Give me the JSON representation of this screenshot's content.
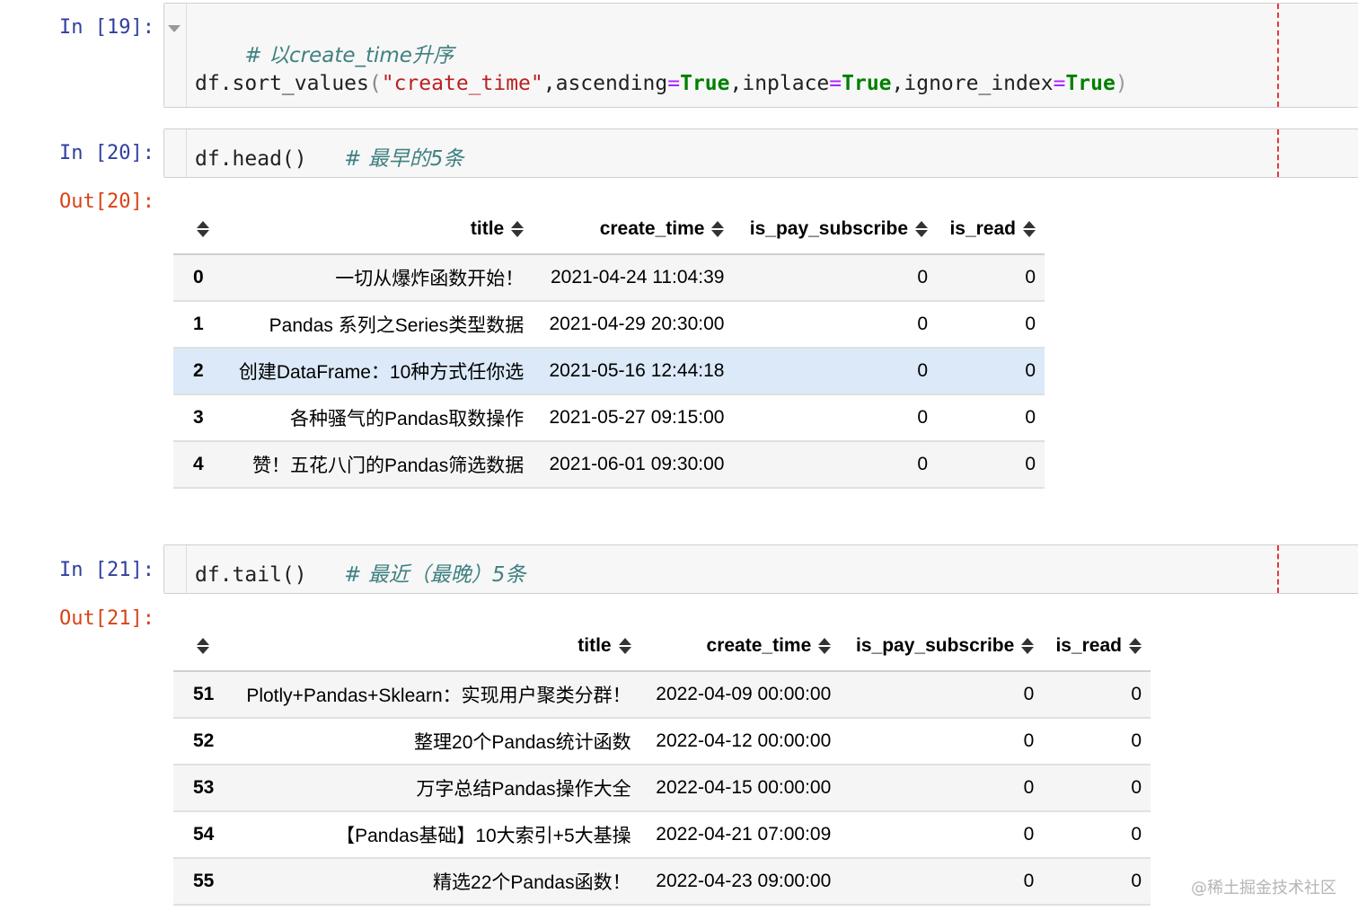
{
  "cells": [
    {
      "prompt": "In [19]:",
      "comment": "# 以create_time升序",
      "code": {
        "call": "df.sort_values",
        "arg_string": "\"create_time\"",
        "kw1": "ascending",
        "v1": "True",
        "kw2": "inplace",
        "v2": "True",
        "kw3": "ignore_index",
        "v3": "True"
      }
    },
    {
      "prompt": "In [20]:",
      "code_text": "df.head()",
      "comment": "# 最早的5条",
      "out_prompt": "Out[20]:"
    },
    {
      "prompt": "In [21]:",
      "code_text": "df.tail()",
      "comment": "# 最近（最晚）5条",
      "out_prompt": "Out[21]:"
    }
  ],
  "columns": [
    "title",
    "create_time",
    "is_pay_subscribe",
    "is_read"
  ],
  "head_table": {
    "rows": [
      {
        "idx": "0",
        "title": "一切从爆炸函数开始！",
        "create_time": "2021-04-24 11:04:39",
        "is_pay_subscribe": "0",
        "is_read": "0"
      },
      {
        "idx": "1",
        "title": "Pandas 系列之Series类型数据",
        "create_time": "2021-04-29 20:30:00",
        "is_pay_subscribe": "0",
        "is_read": "0"
      },
      {
        "idx": "2",
        "title": "创建DataFrame：10种方式任你选",
        "create_time": "2021-05-16 12:44:18",
        "is_pay_subscribe": "0",
        "is_read": "0"
      },
      {
        "idx": "3",
        "title": "各种骚气的Pandas取数操作",
        "create_time": "2021-05-27 09:15:00",
        "is_pay_subscribe": "0",
        "is_read": "0"
      },
      {
        "idx": "4",
        "title": "赞！五花八门的Pandas筛选数据",
        "create_time": "2021-06-01 09:30:00",
        "is_pay_subscribe": "0",
        "is_read": "0"
      }
    ]
  },
  "tail_table": {
    "rows": [
      {
        "idx": "51",
        "title": "Plotly+Pandas+Sklearn：实现用户聚类分群！",
        "create_time": "2022-04-09 00:00:00",
        "is_pay_subscribe": "0",
        "is_read": "0"
      },
      {
        "idx": "52",
        "title": "整理20个Pandas统计函数",
        "create_time": "2022-04-12 00:00:00",
        "is_pay_subscribe": "0",
        "is_read": "0"
      },
      {
        "idx": "53",
        "title": "万字总结Pandas操作大全",
        "create_time": "2022-04-15 00:00:00",
        "is_pay_subscribe": "0",
        "is_read": "0"
      },
      {
        "idx": "54",
        "title": "【Pandas基础】10大索引+5大基操",
        "create_time": "2022-04-21 07:00:09",
        "is_pay_subscribe": "0",
        "is_read": "0"
      },
      {
        "idx": "55",
        "title": "精选22个Pandas函数！",
        "create_time": "2022-04-23 09:00:00",
        "is_pay_subscribe": "0",
        "is_read": "0"
      }
    ]
  },
  "watermark": "@稀土掘金技术社区",
  "colors": {
    "in_prompt": "#303f9f",
    "out_prompt": "#d84315",
    "comment": "#408080",
    "string": "#ba2121",
    "keyword": "#008000",
    "selected_row": "#dbe9f8",
    "ruler": "#e53935"
  }
}
